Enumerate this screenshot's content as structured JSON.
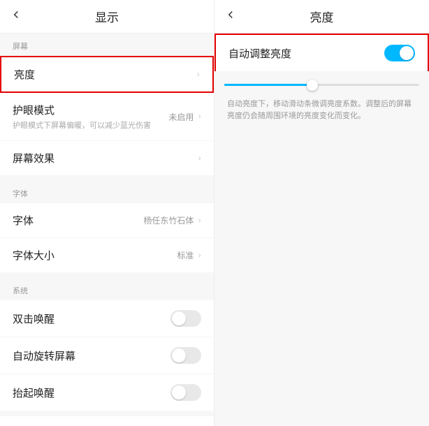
{
  "left": {
    "title": "显示",
    "sections": {
      "screen": {
        "label": "屏幕",
        "brightness": "亮度",
        "eyecare": "护眼模式",
        "eyecare_sub": "护眼模式下屏幕偏暖，可以减少蓝光伤害",
        "eyecare_value": "未启用",
        "effect": "屏幕效果"
      },
      "font": {
        "label": "字体",
        "font": "字体",
        "font_value": "杨任东竹石体",
        "size": "字体大小",
        "size_value": "标准"
      },
      "system": {
        "label": "系统",
        "doubletap": "双击唤醒",
        "autorotate": "自动旋转屏幕",
        "lift": "抬起唤醒"
      }
    }
  },
  "right": {
    "title": "亮度",
    "auto_brightness": "自动调整亮度",
    "help": "自动亮度下，移动滑动条微调亮度系数。调整后的屏幕亮度仍会随周围环境的亮度变化而变化。"
  }
}
